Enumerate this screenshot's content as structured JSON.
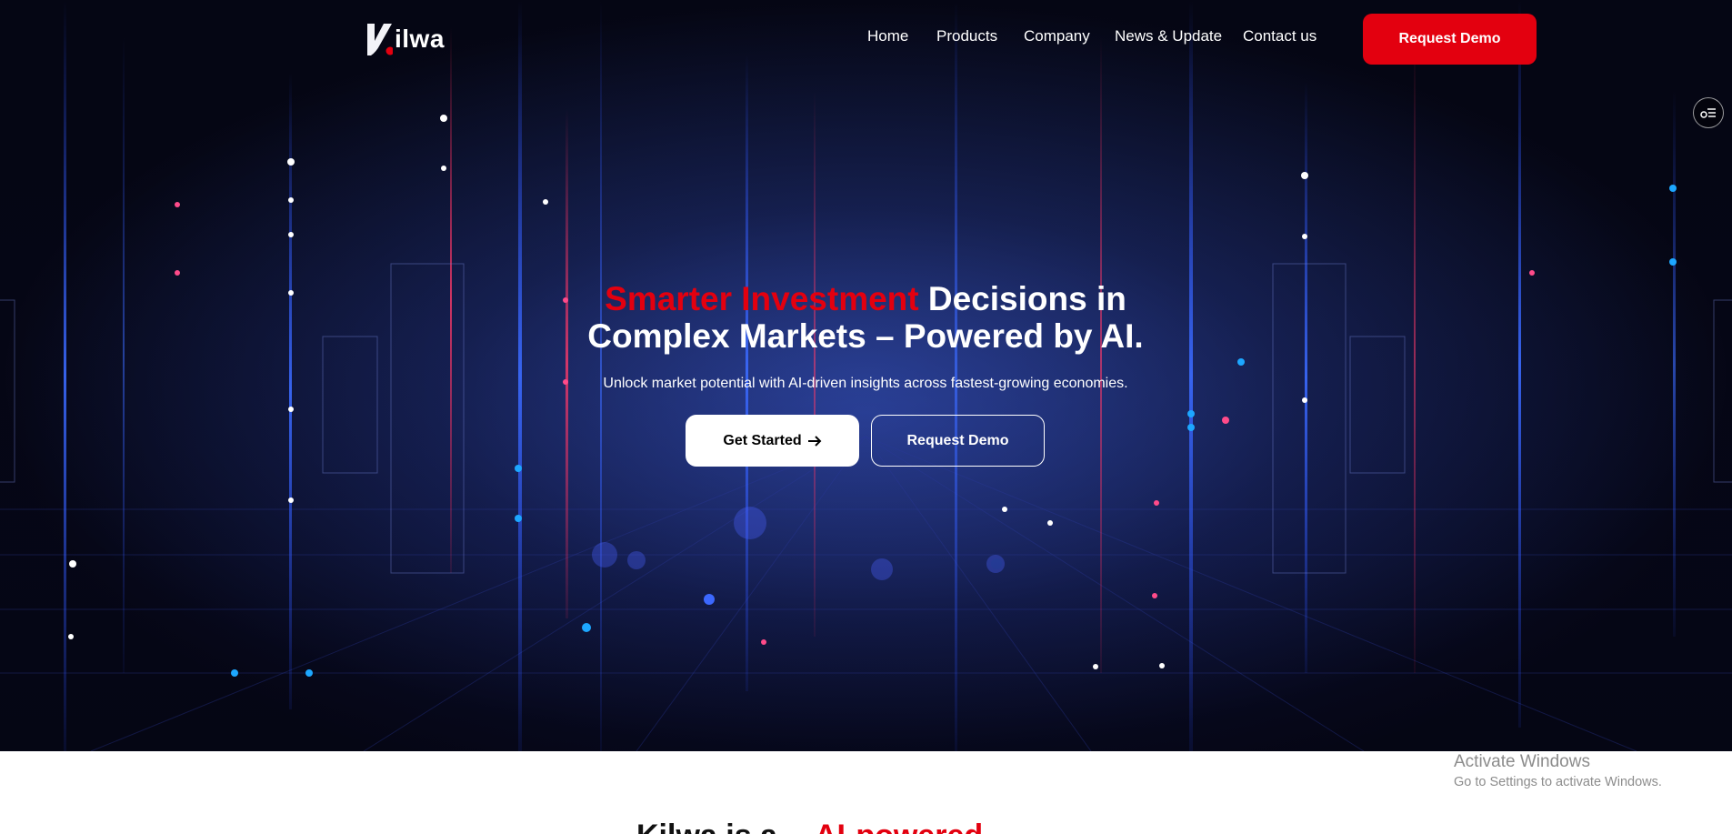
{
  "brand": {
    "logo_text": "ilwa",
    "accent_color": "#e3000f"
  },
  "nav": {
    "items": [
      "Home",
      "Products",
      "Company",
      "News & Update",
      "Contact us"
    ],
    "cta_label": "Request Demo"
  },
  "hero": {
    "headline_accent": "Smarter Investment",
    "headline_rest_line1": " Decisions in",
    "headline_line2": "Complex Markets – Powered by AI.",
    "subheadline": "Unlock market potential with AI-driven insights across fastest-growing economies.",
    "primary_button": "Get Started",
    "primary_button_icon": "arrow-right-icon",
    "secondary_button": "Request Demo",
    "side_toggle_icon": "settings-toggle-icon"
  },
  "next_section": {
    "title_start": "Kilwa is a",
    "title_accent": "AI-powered"
  },
  "watermark": {
    "line1": "Activate Windows",
    "line2": "Go to Settings to activate Windows."
  }
}
